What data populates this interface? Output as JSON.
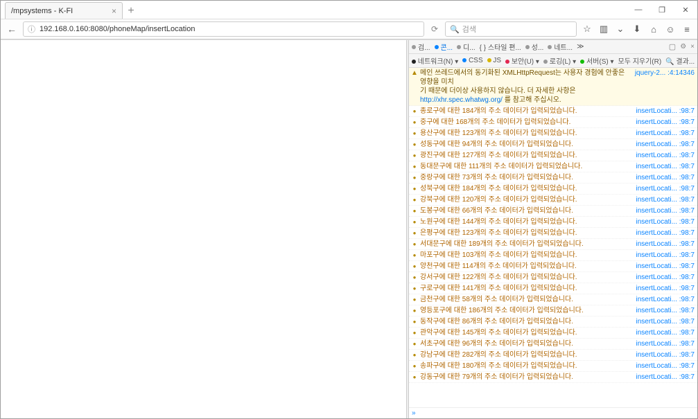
{
  "window": {
    "tab_title": "/mpsystems - K-FI",
    "minimize": "—",
    "maximize": "❐",
    "close": "✕"
  },
  "nav": {
    "back": "←",
    "info_icon": "ⓘ",
    "url": "192.168.0.160:8080/phoneMap/insertLocation",
    "reload": "⟳"
  },
  "search": {
    "icon": "🔍",
    "placeholder": "검색"
  },
  "toolbar_icons": {
    "star": "☆",
    "lib": "▥",
    "pocket": "⌄",
    "download": "⬇",
    "home": "⌂",
    "smile": "☺",
    "menu": "≡"
  },
  "devtools": {
    "row1": {
      "inspector": "검...",
      "console": "콘...",
      "debugger": "디...",
      "style": "{ } 스타일 편...",
      "perf": "성...",
      "net": "네트...",
      "more": "≫"
    },
    "row2": {
      "net_access": "네트워크(N)",
      "css": "CSS",
      "js": "JS",
      "security": "보안(U)",
      "logging": "로깅(L)",
      "server": "서버(S)",
      "clear": "모두 지우기(R)",
      "filter": "결과..."
    },
    "warn": {
      "text_line1": "메인 쓰레드에서의 동기화된 XMLHttpRequest는 사용자 경험에 안좋은 영향을 미치",
      "text_line2": "기 때문에 더이상 사용하지 않습니다. 더 자세한 사항은",
      "text_url": "http://xhr.spec.whatwg.org/",
      "text_tail": " 를 참고해 주십시오.",
      "src": "jquery-2... :4:14346"
    },
    "log_src": "insertLocati... :98:7",
    "logs": [
      "종로구에 대한 184개의 주소 데이터가 입력되었습니다.",
      "중구에 대한 168개의 주소 데이터가 입력되었습니다.",
      "용산구에 대한 123개의 주소 데이터가 입력되었습니다.",
      "성동구에 대한 94개의 주소 데이터가 입력되었습니다.",
      "광진구에 대한 127개의 주소 데이터가 입력되었습니다.",
      "동대문구에 대한 111개의 주소 데이터가 입력되었습니다.",
      "중랑구에 대한 73개의 주소 데이터가 입력되었습니다.",
      "성북구에 대한 184개의 주소 데이터가 입력되었습니다.",
      "강북구에 대한 120개의 주소 데이터가 입력되었습니다.",
      "도봉구에 대한 66개의 주소 데이터가 입력되었습니다.",
      "노원구에 대한 144개의 주소 데이터가 입력되었습니다.",
      "은평구에 대한 123개의 주소 데이터가 입력되었습니다.",
      "서대문구에 대한 189개의 주소 데이터가 입력되었습니다.",
      "마포구에 대한 103개의 주소 데이터가 입력되었습니다.",
      "양천구에 대한 114개의 주소 데이터가 입력되었습니다.",
      "강서구에 대한 122개의 주소 데이터가 입력되었습니다.",
      "구로구에 대한 141개의 주소 데이터가 입력되었습니다.",
      "금천구에 대한 58개의 주소 데이터가 입력되었습니다.",
      "영등포구에 대한 186개의 주소 데이터가 입력되었습니다.",
      "동작구에 대한 86개의 주소 데이터가 입력되었습니다.",
      "관악구에 대한 145개의 주소 데이터가 입력되었습니다.",
      "서초구에 대한 96개의 주소 데이터가 입력되었습니다.",
      "강남구에 대한 282개의 주소 데이터가 입력되었습니다.",
      "송파구에 대한 180개의 주소 데이터가 입력되었습니다.",
      "강동구에 대한 79개의 주소 데이터가 입력되었습니다."
    ]
  }
}
